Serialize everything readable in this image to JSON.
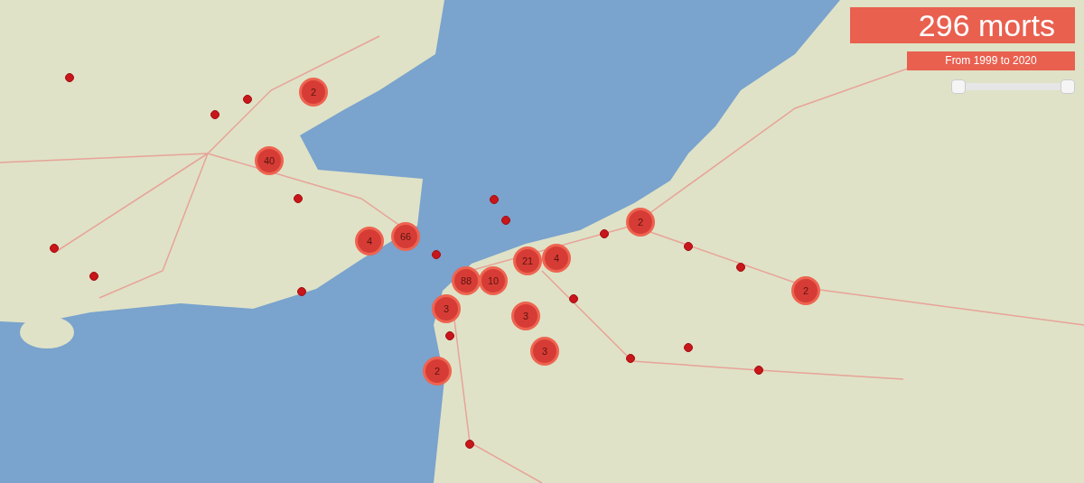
{
  "summary": {
    "title": "296 morts",
    "period": "From 1999 to 2020"
  },
  "year_slider": {
    "handles": [
      {
        "level": 0
      },
      {
        "level": 1
      }
    ]
  },
  "clusters": [
    {
      "count": "2"
    },
    {
      "count": "40"
    },
    {
      "count": "4"
    },
    {
      "count": "66"
    },
    {
      "count": "88"
    },
    {
      "count": "10"
    },
    {
      "count": "21"
    },
    {
      "count": "4"
    },
    {
      "count": "3"
    },
    {
      "count": "3"
    },
    {
      "count": "3"
    },
    {
      "count": "2"
    },
    {
      "count": "2"
    },
    {
      "count": "2"
    }
  ]
}
